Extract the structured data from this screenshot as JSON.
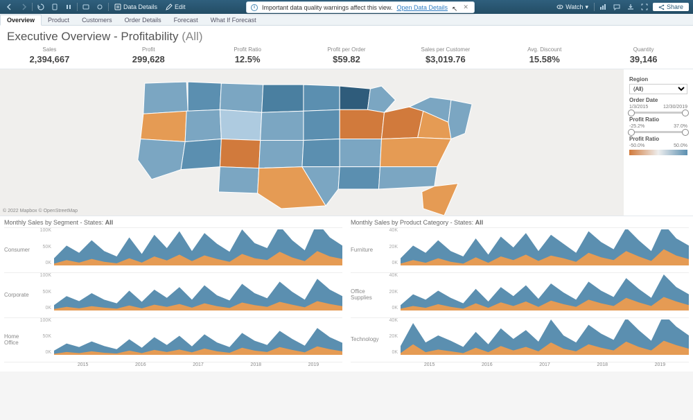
{
  "toolbar": {
    "data_details": "Data Details",
    "edit": "Edit",
    "watch": "Watch",
    "share": "Share"
  },
  "warning": {
    "text": "Important data quality warnings affect this view.",
    "link": "Open Data Details"
  },
  "tabs": [
    "Overview",
    "Product",
    "Customers",
    "Order Details",
    "Forecast",
    "What If Forecast"
  ],
  "active_tab": "Overview",
  "title": {
    "main": "Executive Overview - Profitability",
    "suffix": "(All)"
  },
  "kpis": [
    {
      "label": "Sales",
      "value": "2,394,667"
    },
    {
      "label": "Profit",
      "value": "299,628"
    },
    {
      "label": "Profit Ratio",
      "value": "12.5%"
    },
    {
      "label": "Profit per Order",
      "value": "$59.82"
    },
    {
      "label": "Sales per Customer",
      "value": "$3,019.76"
    },
    {
      "label": "Avg. Discount",
      "value": "15.58%"
    },
    {
      "label": "Quantity",
      "value": "39,146"
    }
  ],
  "map_credit": "© 2022 Mapbox  © OpenStreetMap",
  "filters": {
    "region": {
      "label": "Region",
      "selected": "(All)"
    },
    "order_date": {
      "label": "Order Date",
      "from": "1/3/2015",
      "to": "12/30/2019"
    },
    "profit_ratio": {
      "label": "Profit Ratio",
      "from": "-25.2%",
      "to": "37.0%"
    },
    "legend": {
      "label": "Profit Ratio",
      "from": "-50.0%",
      "to": "50.0%"
    }
  },
  "sm_left": {
    "title": "Monthly Sales by Segment - States:",
    "states": "All",
    "rows": [
      "Consumer",
      "Corporate",
      "Home Office"
    ],
    "yticks": [
      "100K",
      "50K",
      "0K"
    ]
  },
  "sm_right": {
    "title": "Monthly Sales by Product Category - States:",
    "states": "All",
    "rows": [
      "Furniture",
      "Office Supplies",
      "Technology"
    ],
    "yticks": [
      "40K",
      "20K",
      "0K"
    ]
  },
  "xaxis": [
    "2015",
    "2016",
    "2017",
    "2018",
    "2019"
  ],
  "chart_data": {
    "type": "area",
    "x": [
      "2015",
      "2016",
      "2017",
      "2018",
      "2019"
    ],
    "note": "Values approximate monthly sales read from stacked area charts (K = thousands). Blue series stacked on top of orange.",
    "segment_ymax": 100,
    "category_ymax": 40,
    "segments": {
      "Consumer": {
        "orange": [
          5,
          15,
          8,
          18,
          10,
          6,
          20,
          8,
          25,
          14,
          30,
          12,
          28,
          18,
          10,
          32,
          20,
          15,
          38,
          22,
          12,
          40,
          25,
          18
        ],
        "blue": [
          20,
          55,
          35,
          70,
          40,
          25,
          78,
          32,
          85,
          48,
          95,
          40,
          90,
          60,
          38,
          100,
          62,
          48,
          110,
          70,
          42,
          120,
          78,
          55
        ]
      },
      "Corporate": {
        "orange": [
          4,
          10,
          6,
          12,
          8,
          5,
          14,
          6,
          16,
          10,
          18,
          8,
          20,
          12,
          7,
          22,
          15,
          10,
          24,
          16,
          9,
          26,
          18,
          12
        ],
        "blue": [
          15,
          40,
          26,
          48,
          30,
          20,
          55,
          24,
          58,
          35,
          65,
          30,
          70,
          42,
          28,
          74,
          48,
          34,
          80,
          52,
          30,
          88,
          58,
          40
        ]
      },
      "Home Office": {
        "orange": [
          3,
          8,
          5,
          10,
          6,
          4,
          12,
          5,
          14,
          8,
          15,
          7,
          18,
          10,
          6,
          20,
          12,
          8,
          22,
          14,
          7,
          24,
          16,
          10
        ],
        "blue": [
          12,
          32,
          22,
          38,
          25,
          16,
          44,
          20,
          50,
          28,
          54,
          24,
          58,
          35,
          22,
          62,
          40,
          28,
          68,
          45,
          26,
          76,
          50,
          34
        ]
      }
    },
    "categories": {
      "Furniture": {
        "orange": [
          2,
          6,
          3,
          8,
          4,
          2,
          9,
          3,
          10,
          6,
          12,
          5,
          11,
          8,
          4,
          14,
          9,
          6,
          16,
          10,
          5,
          18,
          11,
          7
        ],
        "blue": [
          8,
          22,
          14,
          28,
          16,
          10,
          30,
          12,
          32,
          20,
          36,
          16,
          34,
          24,
          14,
          38,
          26,
          18,
          42,
          28,
          16,
          46,
          30,
          22
        ]
      },
      "Office Supplies": {
        "orange": [
          2,
          5,
          3,
          7,
          4,
          2,
          8,
          3,
          9,
          5,
          10,
          4,
          11,
          7,
          4,
          12,
          8,
          5,
          14,
          9,
          5,
          15,
          10,
          6
        ],
        "blue": [
          6,
          18,
          12,
          22,
          14,
          8,
          24,
          10,
          26,
          16,
          28,
          13,
          30,
          20,
          12,
          32,
          22,
          15,
          36,
          24,
          14,
          40,
          26,
          18
        ]
      },
      "Technology": {
        "orange": [
          2,
          12,
          3,
          6,
          4,
          2,
          8,
          3,
          10,
          5,
          9,
          4,
          14,
          7,
          4,
          12,
          8,
          5,
          15,
          9,
          5,
          16,
          11,
          7
        ],
        "blue": [
          10,
          36,
          14,
          22,
          16,
          9,
          26,
          12,
          30,
          18,
          28,
          15,
          40,
          22,
          14,
          34,
          24,
          17,
          42,
          28,
          16,
          46,
          32,
          22
        ]
      }
    }
  }
}
